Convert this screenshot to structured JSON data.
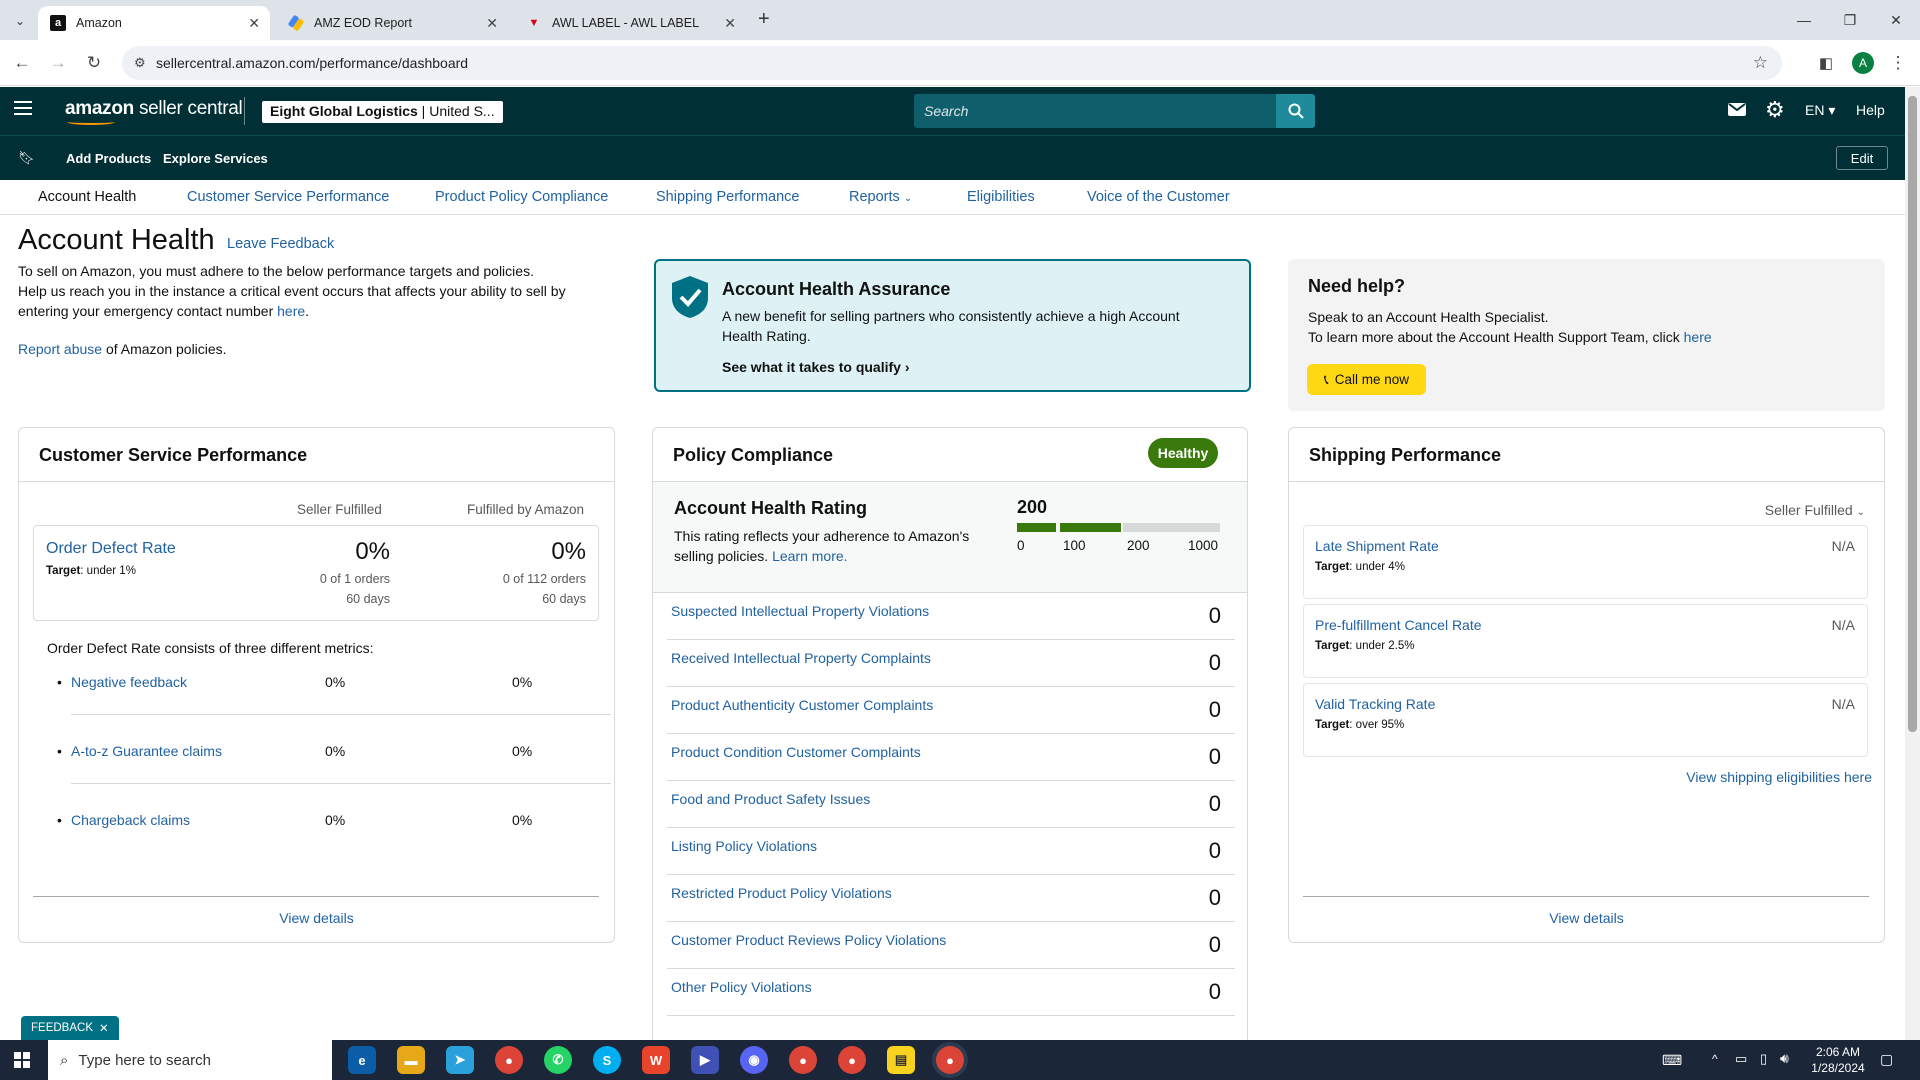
{
  "browser": {
    "tabs": [
      {
        "title": "Amazon",
        "favicon": "a"
      },
      {
        "title": "AMZ EOD Report",
        "favicon": "slides"
      },
      {
        "title": "AWL LABEL - AWL LABEL",
        "favicon": "awl"
      }
    ],
    "url": "sellercentral.amazon.com/performance/dashboard",
    "profile_initial": "A"
  },
  "header": {
    "logo_amazon": "amazon",
    "logo_rest": "seller central",
    "account_bold": "Eight Global Logistics",
    "account_rest": " | United S...",
    "search_placeholder": "Search",
    "lang": "EN",
    "help": "Help",
    "add_products": "Add Products",
    "explore_services": "Explore Services",
    "edit": "Edit"
  },
  "pagenav": [
    "Account Health",
    "Customer Service Performance",
    "Product Policy Compliance",
    "Shipping Performance",
    "Reports",
    "Eligibilities",
    "Voice of the Customer"
  ],
  "intro": {
    "title": "Account Health",
    "leave_feedback": "Leave Feedback",
    "line1": "To sell on Amazon, you must adhere to the below performance targets and policies.",
    "line2": "Help us reach you in the instance a critical event occurs that affects your ability to sell by",
    "line3": "entering your emergency contact number ",
    "here": "here",
    "dot": ".",
    "report_abuse": "Report abuse",
    "report_rest": " of Amazon policies."
  },
  "assurance": {
    "title": "Account Health Assurance",
    "desc1": "A new benefit for selling partners who consistently achieve a high Account",
    "desc2": "Health Rating.",
    "cta": "See what it takes to qualify"
  },
  "needhelp": {
    "title": "Need help?",
    "line1": "Speak to an Account Health Specialist.",
    "line2": "To learn more about the Account Health Support Team, click ",
    "here": "here",
    "button": "Call me now"
  },
  "csp": {
    "title": "Customer Service Performance",
    "col1": "Seller Fulfilled",
    "col2": "Fulfilled by Amazon",
    "odr_label": "Order Defect Rate",
    "target_word": "Target",
    "odr_target": ": under 1%",
    "odr_sf": "0%",
    "odr_fba": "0%",
    "odr_sf_orders": "0 of 1 orders",
    "odr_fba_orders": "0 of 112 orders",
    "days": "60 days",
    "consists": "Order Defect Rate consists of three different metrics:",
    "metrics": [
      {
        "label": "Negative feedback",
        "sf": "0%",
        "fba": "0%"
      },
      {
        "label": "A-to-z Guarantee claims",
        "sf": "0%",
        "fba": "0%"
      },
      {
        "label": "Chargeback claims",
        "sf": "0%",
        "fba": "0%"
      }
    ],
    "view_details": "View details"
  },
  "policy": {
    "title": "Policy Compliance",
    "badge": "Healthy",
    "ahr_title": "Account Health Rating",
    "ahr_desc1": "This rating reflects your adherence to Amazon's",
    "ahr_desc2": "selling policies. ",
    "learn_more": "Learn more.",
    "score": "200",
    "score_fraction": 0.2,
    "scale": [
      "0",
      "100",
      "200",
      "1000"
    ],
    "rows": [
      {
        "label": "Suspected Intellectual Property Violations",
        "value": "0"
      },
      {
        "label": "Received Intellectual Property Complaints",
        "value": "0"
      },
      {
        "label": "Product Authenticity Customer Complaints",
        "value": "0"
      },
      {
        "label": "Product Condition Customer Complaints",
        "value": "0"
      },
      {
        "label": "Food and Product Safety Issues",
        "value": "0"
      },
      {
        "label": "Listing Policy Violations",
        "value": "0"
      },
      {
        "label": "Restricted Product Policy Violations",
        "value": "0"
      },
      {
        "label": "Customer Product Reviews Policy Violations",
        "value": "0"
      },
      {
        "label": "Other Policy Violations",
        "value": "0"
      }
    ]
  },
  "shipping": {
    "title": "Shipping Performance",
    "filter": "Seller Fulfilled",
    "rows": [
      {
        "label": "Late Shipment Rate",
        "target": ": under 4%",
        "value": "N/A"
      },
      {
        "label": "Pre-fulfillment Cancel Rate",
        "target": ": under 2.5%",
        "value": "N/A"
      },
      {
        "label": "Valid Tracking Rate",
        "target": ": over 95%",
        "value": "N/A"
      }
    ],
    "eligibilities": "View shipping eligibilities here",
    "view_details": "View details"
  },
  "feedback_tab": "FEEDBACK",
  "taskbar": {
    "search": "Type here to search",
    "time": "2:06 AM",
    "date": "1/28/2024"
  },
  "colors": {
    "header": "#002f36",
    "healthy": "#3a7a0c",
    "link": "#2162a1",
    "assurance_border": "#007185"
  }
}
